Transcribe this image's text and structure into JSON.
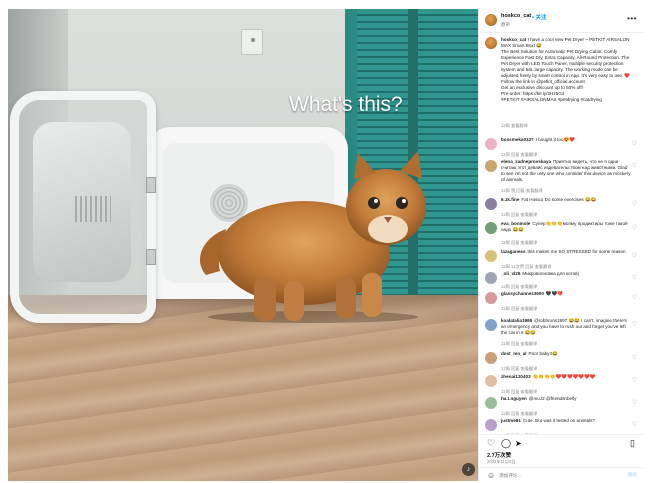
{
  "media": {
    "overlay_text": "What's this?",
    "mute_icon": "speaker-icon"
  },
  "header": {
    "username": "hoskco_cat",
    "follow_label": "• 关注",
    "subtitle": "原声",
    "more_icon": "•••"
  },
  "caption": {
    "username": "hoskco_cat",
    "text": "I have a cool new Pet Dryer ~ PETKIT AIRSALON MAX Smart Box! 😂\nThe Best Solution for Automatic Pet Drying Cabin: Comfy Experience Fast Dry, Extra Capacity, All-Round Protection. The Pet Dryer with LED Touch Panel, multiple security protection system and 56L large capacity. The working mode can be adjusted freely by smart control in App. It's very easy to use. ❤️\nFollow the link in @petkit_official.account\nGet an exclusive discount up to 50% off!\nPre-order: https://bit.ly/2Hz5G4\n#PETKIT #AIRSALONMAX #petdrying #catdrying",
    "meta": "12周   查看翻译"
  },
  "comments": [
    {
      "user": "bossmeka0327",
      "text": "I bought it too😍❤️",
      "meta": "12周   回复   查看翻译"
    },
    {
      "user": "elena_zadneprovskaya",
      "text": "Приятно видеть, что не я одна считаю этот девайс издевательством над животными. Glad to see i'm not the only one who consider this device as mockery of animals.",
      "meta": "12周   赞   回复   查看翻译"
    },
    {
      "user": "6.1k.fine",
      "text": "Fat Hosico Do some exercises 😂😂",
      "meta": "12周   回复   查看翻译"
    },
    {
      "user": "eva_bonmole",
      "text": "Супер👏👏👏мопму продиктиры тоже такой надо 😂😂",
      "meta": "12周   回复   查看翻译"
    },
    {
      "user": "lazaganess",
      "text": "this makes me SO STRESSED for some reason",
      "meta": "12周   12次赞   回复   查看翻译"
    },
    {
      "user": "_oli_xl29",
      "text": "Микроволновка для котов)",
      "meta": "12周   回复   查看翻译"
    },
    {
      "user": "glassychannez3600",
      "text": "🖤🖤💔",
      "meta": "12周   回复   查看翻译"
    },
    {
      "user": "koalatalia1995",
      "text": "@robbruns1997 😂😂 I can't, imagine there's an emergency and you have to rush out and forget you've left the cat in it 😂😂",
      "meta": "12周   回复   查看翻译"
    },
    {
      "user": "dost_mo_al",
      "text": "Poor baby!!😂",
      "meta": "12周   回复   查看翻译"
    },
    {
      "user": "zhenai120403",
      "text": "👏👏👏👏❤️❤️❤️❤️❤️❤️❤️",
      "meta": "12周   回复   查看翻译"
    },
    {
      "user": "ha.t.nguyen",
      "text": "@mu.l2 @friendsnbelly",
      "meta": "12周   回复   查看翻译"
    },
    {
      "user": "justme81",
      "text": "Cute. But was it tested on animals?",
      "meta": "12周   回复   查看翻译"
    }
  ],
  "actions": {
    "like_icon": "♡",
    "comment_icon": "◯",
    "share_icon": "➤",
    "save_icon": "▯",
    "likes": "2.7万次赞",
    "date": "2022年11月3日"
  },
  "add_comment": {
    "emoji_icon": "☺",
    "placeholder": "添加评论...",
    "post_label": "发布"
  },
  "colors": {
    "accent": "#0095f6",
    "shutters": "#2f9690",
    "cat": "#c57a34"
  }
}
